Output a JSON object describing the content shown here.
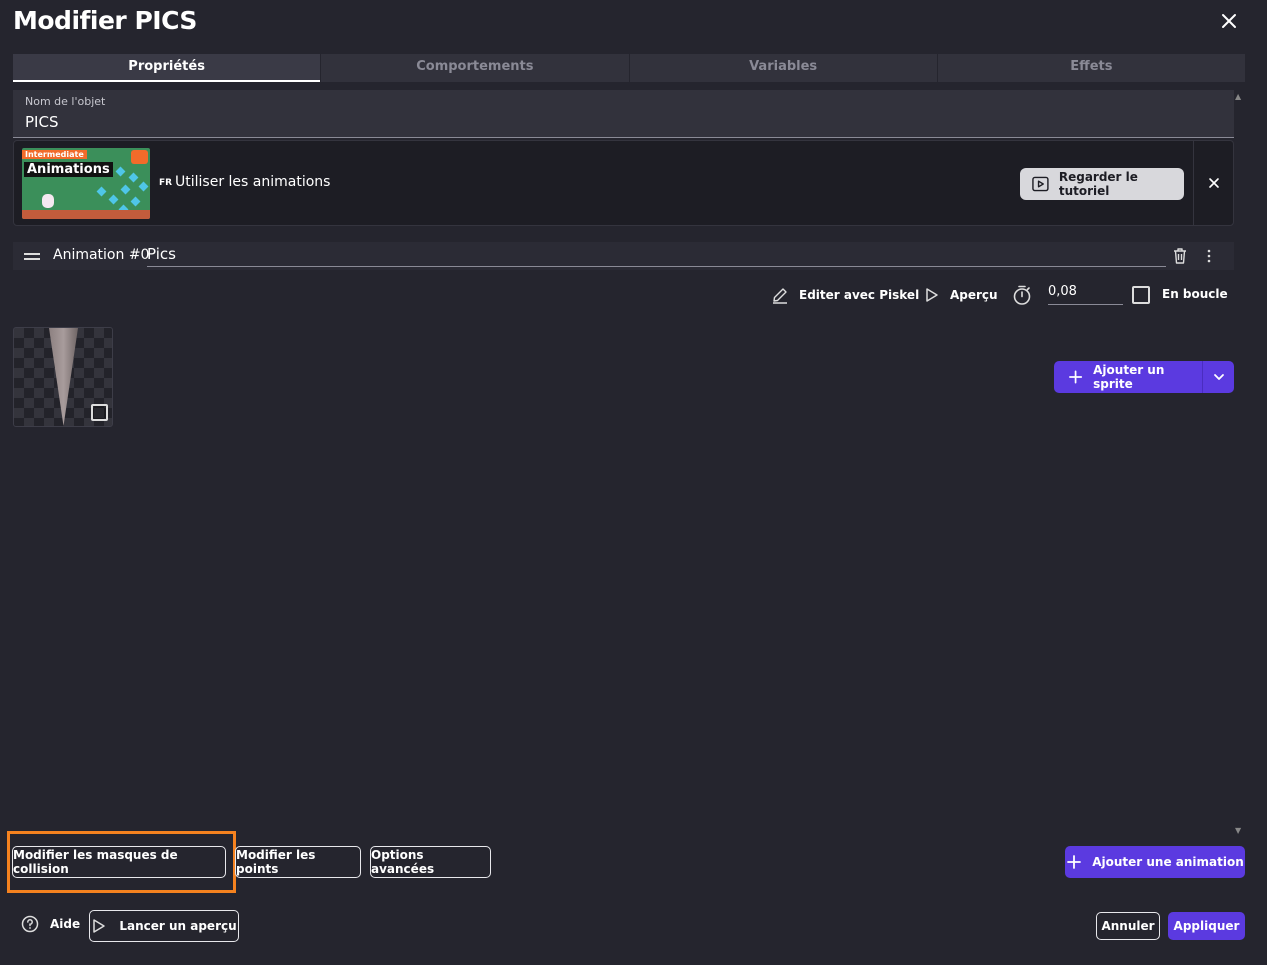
{
  "dialog": {
    "title": "Modifier PICS",
    "close_icon": "close-icon"
  },
  "tabs": [
    {
      "label": "Propriétés",
      "active": true
    },
    {
      "label": "Comportements",
      "active": false
    },
    {
      "label": "Variables",
      "active": false
    },
    {
      "label": "Effets",
      "active": false
    }
  ],
  "object_name": {
    "label": "Nom de l'objet",
    "value": "PICS"
  },
  "tutorial": {
    "thumbnail_badge": "Intermediate",
    "thumbnail_title": "Animations",
    "language": "FR",
    "title": "Utiliser les animations",
    "watch_button": "Regarder le tutoriel"
  },
  "animation": {
    "label": "Animation #0",
    "name": "Pics",
    "toolbar": {
      "edit_piskel": "Editer avec Piskel",
      "preview": "Aperçu",
      "duration": "0,08",
      "loop_label": "En boucle",
      "loop_checked": false
    },
    "add_sprite": "Ajouter un sprite"
  },
  "footer": {
    "edit_collision_masks": "Modifier les masques de collision",
    "edit_points": "Modifier les points",
    "advanced_options": "Options avancées",
    "add_animation": "Ajouter une animation",
    "help": "Aide",
    "launch_preview": "Lancer un aperçu",
    "cancel": "Annuler",
    "apply": "Appliquer"
  },
  "colors": {
    "background": "#25252e",
    "accent": "#5b3ae0",
    "highlight": "#f5821f"
  }
}
